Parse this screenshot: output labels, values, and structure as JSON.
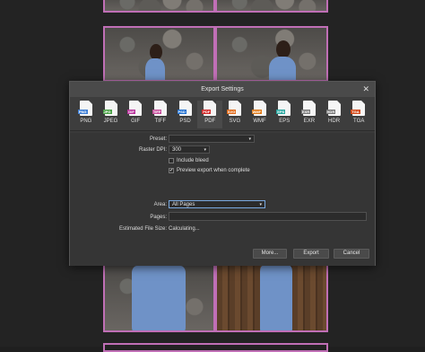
{
  "dialog": {
    "title": "Export Settings",
    "close_glyph": "✕",
    "formats": [
      {
        "label": "PNG",
        "badge": "PNG",
        "color": "#3f7fd6"
      },
      {
        "label": "JPEG",
        "badge": "JPG",
        "color": "#4aa046"
      },
      {
        "label": "GIF",
        "badge": "GIF",
        "color": "#b9359c"
      },
      {
        "label": "TIFF",
        "badge": "TIFF",
        "color": "#c54f9b"
      },
      {
        "label": "PSD",
        "badge": "PSD",
        "color": "#1f6fd0"
      },
      {
        "label": "PDF",
        "badge": "PDF",
        "color": "#d12b2b"
      },
      {
        "label": "SVG",
        "badge": "SVG",
        "color": "#e06a1a"
      },
      {
        "label": "WMF",
        "badge": "WMF",
        "color": "#e07a1a"
      },
      {
        "label": "EPS",
        "badge": "EPS",
        "color": "#2aa7a0"
      },
      {
        "label": "EXR",
        "badge": "EXR",
        "color": "#7a7a7a"
      },
      {
        "label": "HDR",
        "badge": "HDR",
        "color": "#777777"
      },
      {
        "label": "TGA",
        "badge": "TGA",
        "color": "#d34a1a"
      }
    ],
    "selected_format": "PDF",
    "preset": {
      "label": "Preset:",
      "value": ""
    },
    "raster_dpi": {
      "label": "Raster DPI:",
      "value": "300"
    },
    "include_bleed": {
      "label": "Include bleed",
      "checked": false
    },
    "preview": {
      "label": "Preview export when complete",
      "checked": true,
      "glyph": "✔"
    },
    "area": {
      "label": "Area:",
      "value": "All Pages"
    },
    "pages": {
      "label": "Pages:",
      "value": ""
    },
    "estimated": {
      "label": "Estimated File Size:",
      "value": "Calculating..."
    },
    "buttons": {
      "more": "More...",
      "export": "Export",
      "cancel": "Cancel"
    },
    "dropdown_glyph": "▾"
  }
}
